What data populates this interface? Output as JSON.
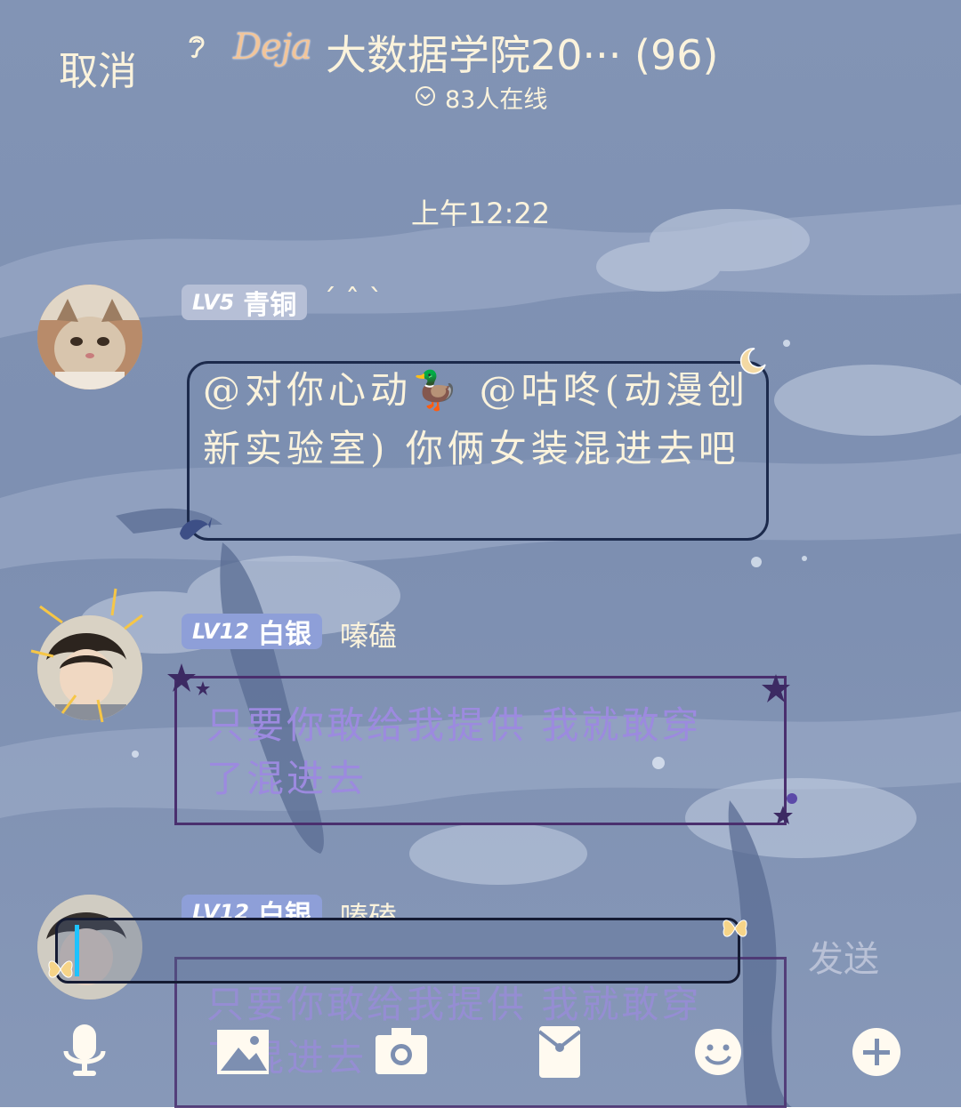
{
  "header": {
    "cancel_label": "取消",
    "deja_text": "Deja",
    "title": "大数据学院20··· (96)",
    "online_text": "83人在线"
  },
  "chat": {
    "timestamp": "上午12:22",
    "messages": [
      {
        "level": "LV5",
        "rank": "青铜",
        "name": "ˊ ˆ ˋ",
        "text": "@对你心动🦆 @咕咚(动漫创新实验室) 你俩女装混进去吧"
      },
      {
        "level": "LV12",
        "rank": "白银",
        "name": "嗪磕",
        "text": "只要你敢给我提供 我就敢穿了混进去"
      },
      {
        "level": "LV12",
        "rank": "白银",
        "name": "嗪磕",
        "text": "只要你敢给我提供 我就敢穿了混进去"
      }
    ]
  },
  "input": {
    "value": "",
    "send_label": "发送"
  },
  "toolbar": {
    "icons": [
      "microphone-icon",
      "image-icon",
      "camera-icon",
      "red-packet-icon",
      "emoji-icon",
      "plus-icon"
    ]
  },
  "colors": {
    "background": "#8094b4",
    "header_text": "#fbf3dc",
    "bronze_badge": "#b6bfd6",
    "silver_badge": "#8e9fd8",
    "purple_text": "#9c8adf",
    "caret": "#1ec2ff"
  }
}
